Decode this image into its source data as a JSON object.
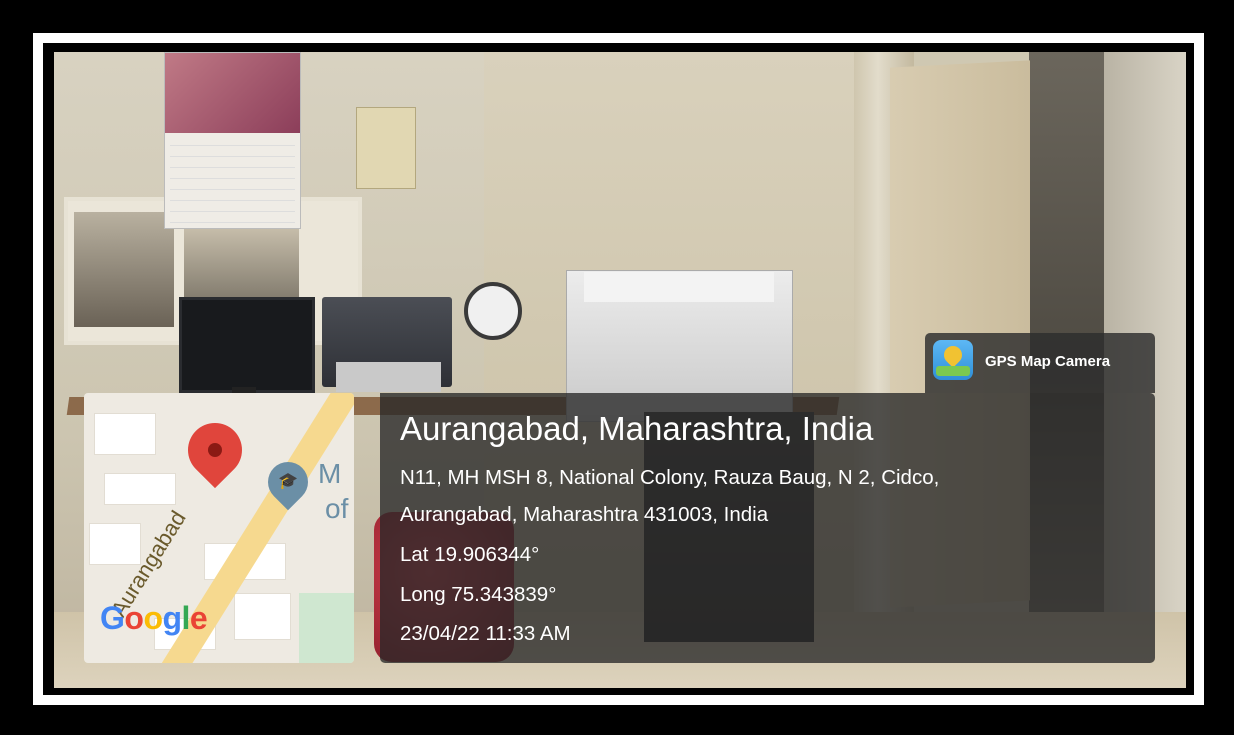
{
  "badge": {
    "app_icon": "gps-map-camera-icon",
    "label": "GPS Map Camera"
  },
  "map": {
    "road_label": "Aurangabad",
    "poi_icon": "school-marker-icon",
    "poi_label_line1": "M",
    "poi_label_line2": "of",
    "pin_icon": "location-pin-icon",
    "logo": "Google"
  },
  "location": {
    "title": "Aurangabad, Maharashtra, India",
    "address_line1": "N11, MH MSH 8, National Colony, Rauza Baug, N 2, Cidco,",
    "address_line2": "Aurangabad, Maharashtra 431003, India",
    "latitude": "Lat 19.906344°",
    "longitude": "Long 75.343839°",
    "timestamp": "23/04/22 11:33 AM"
  }
}
